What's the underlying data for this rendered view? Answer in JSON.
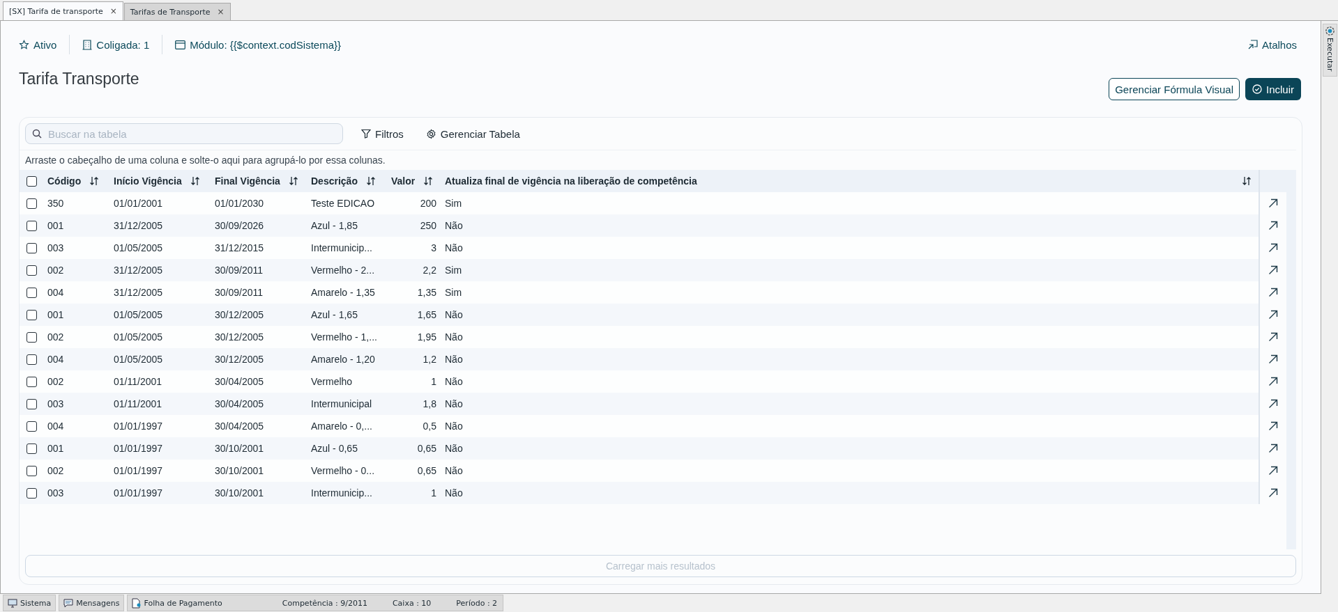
{
  "doc_tabs": [
    {
      "label": "[SX] Tarifa de transporte",
      "close": "×",
      "selected": true
    },
    {
      "label": "Tarifas de Transporte",
      "close": "×",
      "selected": false
    }
  ],
  "side_panel": {
    "label": "Executar"
  },
  "header": {
    "status": "Ativo",
    "company": "Coligada: 1",
    "module": "Módulo: {{$context.codSistema}}",
    "shortcuts": "Atalhos"
  },
  "title": "Tarifa Transporte",
  "actions": {
    "secondary": "Gerenciar Fórmula Visual",
    "primary": "Incluir"
  },
  "toolbar": {
    "search_placeholder": "Buscar na tabela",
    "filters": "Filtros",
    "manage": "Gerenciar Tabela"
  },
  "group_hint": "Arraste o cabeçalho de uma coluna e solte-o aqui para agrupá-lo por essa colunas.",
  "table": {
    "all_checked": false,
    "columns": [
      "Código",
      "Início Vigência",
      "Final Vigência",
      "Descrição",
      "Valor",
      "Atualiza final de vigência na liberação de competência"
    ],
    "rows": [
      {
        "checked": false,
        "cells": [
          "350",
          "01/01/2001",
          "01/01/2030",
          "Teste EDICAO",
          "200",
          "Sim"
        ]
      },
      {
        "checked": false,
        "cells": [
          "001",
          "31/12/2005",
          "30/09/2026",
          "Azul - 1,85",
          "250",
          "Não"
        ]
      },
      {
        "checked": false,
        "cells": [
          "003",
          "01/05/2005",
          "31/12/2015",
          "Intermunicip...",
          "3",
          "Não"
        ]
      },
      {
        "checked": false,
        "cells": [
          "002",
          "31/12/2005",
          "30/09/2011",
          "Vermelho - 2...",
          "2,2",
          "Sim"
        ]
      },
      {
        "checked": false,
        "cells": [
          "004",
          "31/12/2005",
          "30/09/2011",
          "Amarelo - 1,35",
          "1,35",
          "Sim"
        ]
      },
      {
        "checked": false,
        "cells": [
          "001",
          "01/05/2005",
          "30/12/2005",
          "Azul - 1,65",
          "1,65",
          "Não"
        ]
      },
      {
        "checked": false,
        "cells": [
          "002",
          "01/05/2005",
          "30/12/2005",
          "Vermelho - 1,...",
          "1,95",
          "Não"
        ]
      },
      {
        "checked": false,
        "cells": [
          "004",
          "01/05/2005",
          "30/12/2005",
          "Amarelo - 1,20",
          "1,2",
          "Não"
        ]
      },
      {
        "checked": false,
        "cells": [
          "002",
          "01/11/2001",
          "30/04/2005",
          "Vermelho",
          "1",
          "Não"
        ]
      },
      {
        "checked": false,
        "cells": [
          "003",
          "01/11/2001",
          "30/04/2005",
          "Intermunicipal",
          "1,8",
          "Não"
        ]
      },
      {
        "checked": false,
        "cells": [
          "004",
          "01/01/1997",
          "30/04/2005",
          "Amarelo - 0,...",
          "0,5",
          "Não"
        ]
      },
      {
        "checked": false,
        "cells": [
          "001",
          "01/01/1997",
          "30/10/2001",
          "Azul - 0,65",
          "0,65",
          "Não"
        ]
      },
      {
        "checked": false,
        "cells": [
          "002",
          "01/01/1997",
          "30/10/2001",
          "Vermelho - 0...",
          "0,65",
          "Não"
        ]
      },
      {
        "checked": false,
        "cells": [
          "003",
          "01/01/1997",
          "30/10/2001",
          "Intermunicip...",
          "1",
          "Não"
        ]
      }
    ],
    "load_more": {
      "label": "Carregar mais resultados",
      "disabled": true
    }
  },
  "status_bar": {
    "system": "Sistema",
    "messages": "Mensagens",
    "module": "Folha de Pagamento",
    "competence": "Competência : 9/2011",
    "cash": "Caixa : 10",
    "period": "Período : 2"
  }
}
